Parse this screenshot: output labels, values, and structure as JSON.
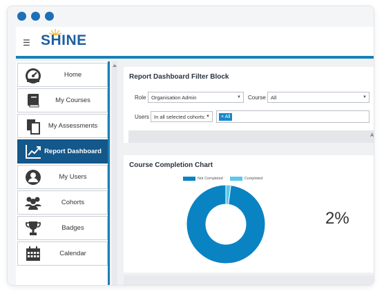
{
  "header": {
    "menu_icon": "hamburger-icon",
    "logo_text": "SHINE"
  },
  "sidebar": {
    "items": [
      {
        "label": "Home",
        "icon": "dashboard-gauge-icon",
        "active": false
      },
      {
        "label": "My Courses",
        "icon": "book-icon",
        "active": false
      },
      {
        "label": "My Assessments",
        "icon": "documents-icon",
        "active": false
      },
      {
        "label": "Report Dashboard",
        "icon": "trend-chart-icon",
        "active": true
      },
      {
        "label": "My Users",
        "icon": "user-icon",
        "active": false
      },
      {
        "label": "Cohorts",
        "icon": "group-icon",
        "active": false
      },
      {
        "label": "Badges",
        "icon": "trophy-icon",
        "active": false
      },
      {
        "label": "Calendar",
        "icon": "calendar-icon",
        "active": false
      }
    ]
  },
  "filter": {
    "title": "Report Dashboard Filter Block",
    "role_label": "Role",
    "role_value": "Organisation Admin",
    "course_label": "Course",
    "course_value": "All",
    "users_label": "Users",
    "users_value": "In all selected cohorts:",
    "users_tag": "× All",
    "bar_text": "A"
  },
  "chart_panel": {
    "title": "Course Completion Chart",
    "percentage_text": "2%"
  },
  "chart_data": {
    "type": "pie",
    "title": "Course Completion Chart",
    "categories": [
      "Not Completed",
      "Completed"
    ],
    "values": [
      98,
      2
    ],
    "colors": [
      "#0a83c3",
      "#5bc8ea"
    ],
    "legend_position": "top",
    "donut": true
  },
  "colors": {
    "accent": "#1a7fb5",
    "active_nav": "#13578b",
    "logo": "#1d5fa0",
    "window_dots": "#1d6fb8"
  }
}
